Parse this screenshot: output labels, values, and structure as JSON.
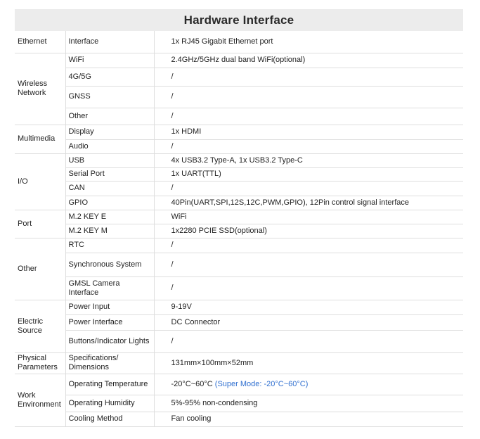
{
  "title": "Hardware Interface",
  "sections": [
    {
      "name": "Ethernet",
      "rows": [
        {
          "label": "Interface",
          "value": "1x RJ45 Gigabit Ethernet port",
          "height": 31
        }
      ]
    },
    {
      "name": "Wireless Network",
      "rows": [
        {
          "label": "WiFi",
          "value": "2.4GHz/5GHz dual band WiFi(optional)",
          "height": 21
        },
        {
          "label": "4G/5G",
          "value": "/",
          "height": 26
        },
        {
          "label": "GNSS",
          "value": "/",
          "height": 31
        },
        {
          "label": "Other",
          "value": "/",
          "height": 24
        }
      ]
    },
    {
      "name": "Multimedia",
      "rows": [
        {
          "label": "Display",
          "value": "1x HDMI",
          "height": 21
        },
        {
          "label": "Audio",
          "value": "/",
          "height": 20
        }
      ]
    },
    {
      "name": "I/O",
      "rows": [
        {
          "label": "USB",
          "value": "4x USB3.2 Type-A, 1x USB3.2 Type-C",
          "height": 20
        },
        {
          "label": "Serial Port",
          "value": "1x UART(TTL)",
          "height": 19
        },
        {
          "label": "CAN",
          "value": "/",
          "height": 21
        },
        {
          "label": "GPIO",
          "value": "40Pin(UART,SPI,12S,12C,PWM,GPIO), 12Pin control signal interface",
          "height": 20
        }
      ]
    },
    {
      "name": "Port",
      "rows": [
        {
          "label": "M.2 KEY E",
          "value": "WiFi",
          "height": 20
        },
        {
          "label": "M.2 KEY M",
          "value": "1x2280 PCIE SSD(optional)",
          "height": 20
        }
      ]
    },
    {
      "name": "Other",
      "rows": [
        {
          "label": "RTC",
          "value": "/",
          "height": 21
        },
        {
          "label": "Synchronous System",
          "value": "/",
          "height": 34
        },
        {
          "label": "GMSL Camera Interface",
          "value": "/",
          "height": 33
        }
      ]
    },
    {
      "name": "Electric Source",
      "rows": [
        {
          "label": "Power Input",
          "value": "9-19V",
          "height": 21
        },
        {
          "label": "Power Interface",
          "value": "DC Connector",
          "height": 22
        },
        {
          "label": "Buttons/Indicator Lights",
          "value": "/",
          "height": 32
        }
      ]
    },
    {
      "name": "Physical Parameters",
      "rows": [
        {
          "label": "Specifications/ Dimensions",
          "value": "131mm×100mm×52mm",
          "height": 30
        }
      ]
    },
    {
      "name": "Work Environment",
      "rows": [
        {
          "label": "Operating Temperature",
          "value": "-20°C~60°C",
          "value_note": "(Super Mode: -20°C~60°C)",
          "height": 30
        },
        {
          "label": "Operating Humidity",
          "value": "5%-95% non-condensing",
          "height": 24
        },
        {
          "label": "Cooling Method",
          "value": "Fan cooling",
          "height": 21
        }
      ]
    }
  ],
  "colors": {
    "highlight": "#2f6fd0",
    "title_bg": "#ececec",
    "border": "#dedede"
  }
}
